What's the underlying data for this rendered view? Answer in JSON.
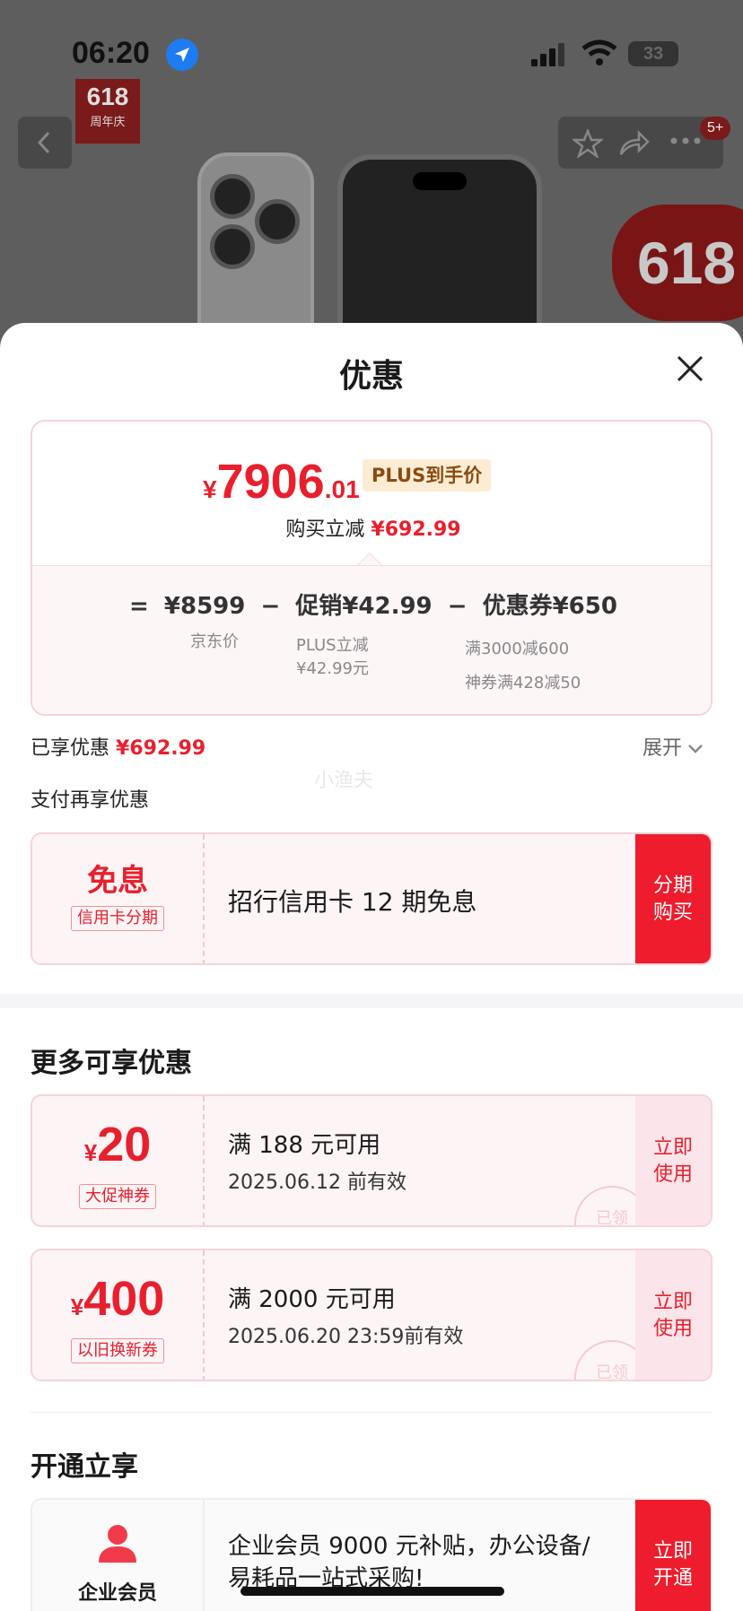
{
  "status_bar": {
    "time": "06:20",
    "battery": "33"
  },
  "bg_page": {
    "anniv_badge_number": "618",
    "anniv_badge_text": "周年庆",
    "notification_badge": "5+",
    "promo_banner": "618"
  },
  "sheet": {
    "title": "优惠",
    "price_card": {
      "currency": "¥",
      "price_int": "7906",
      "price_dec": ".01",
      "plus_tag": "PLUS到手价",
      "reduce_label": "购买立减",
      "reduce_value": "¥692.99",
      "breakdown": {
        "eq": "=",
        "jd_price": "¥8599",
        "minus1": "−",
        "promo": "促销¥42.99",
        "minus2": "−",
        "coupon": "优惠券¥650",
        "jd_price_label": "京东价",
        "promo_sub1": "PLUS立减",
        "promo_sub2": "¥42.99元",
        "coupon_sub1": "满3000减600",
        "coupon_sub2": "神券满428减50"
      }
    },
    "enjoyed_label": "已享优惠",
    "enjoyed_value": "¥692.99",
    "expand_label": "展开",
    "watermark": "小渔夫",
    "pay_section_title": "支付再享优惠",
    "installment": {
      "big": "免息",
      "tag": "信用卡分期",
      "desc": "招行信用卡 12 期免息",
      "action_line1": "分期",
      "action_line2": "购买"
    },
    "more_title": "更多可享优惠",
    "coupons": [
      {
        "currency": "¥",
        "amount": "20",
        "tag": "大促神券",
        "cond": "满 188 元可用",
        "expiry": "2025.06.12 前有效",
        "action_line1": "立即",
        "action_line2": "使用",
        "stamp": "已领"
      },
      {
        "currency": "¥",
        "amount": "400",
        "tag": "以旧换新券",
        "cond": "满 2000 元可用",
        "expiry": "2025.06.20 23:59前有效",
        "action_line1": "立即",
        "action_line2": "使用",
        "stamp": "已领"
      }
    ],
    "open_title": "开通立享",
    "membership": {
      "label": "企业会员",
      "desc": "企业会员 9000 元补贴，办公设备/易耗品一站式采购!",
      "action_line1": "立即",
      "action_line2": "开通"
    }
  },
  "colors": {
    "accent": "#e8202e",
    "button_red": "#ee1c2c",
    "card_border": "#f6d3d9"
  }
}
